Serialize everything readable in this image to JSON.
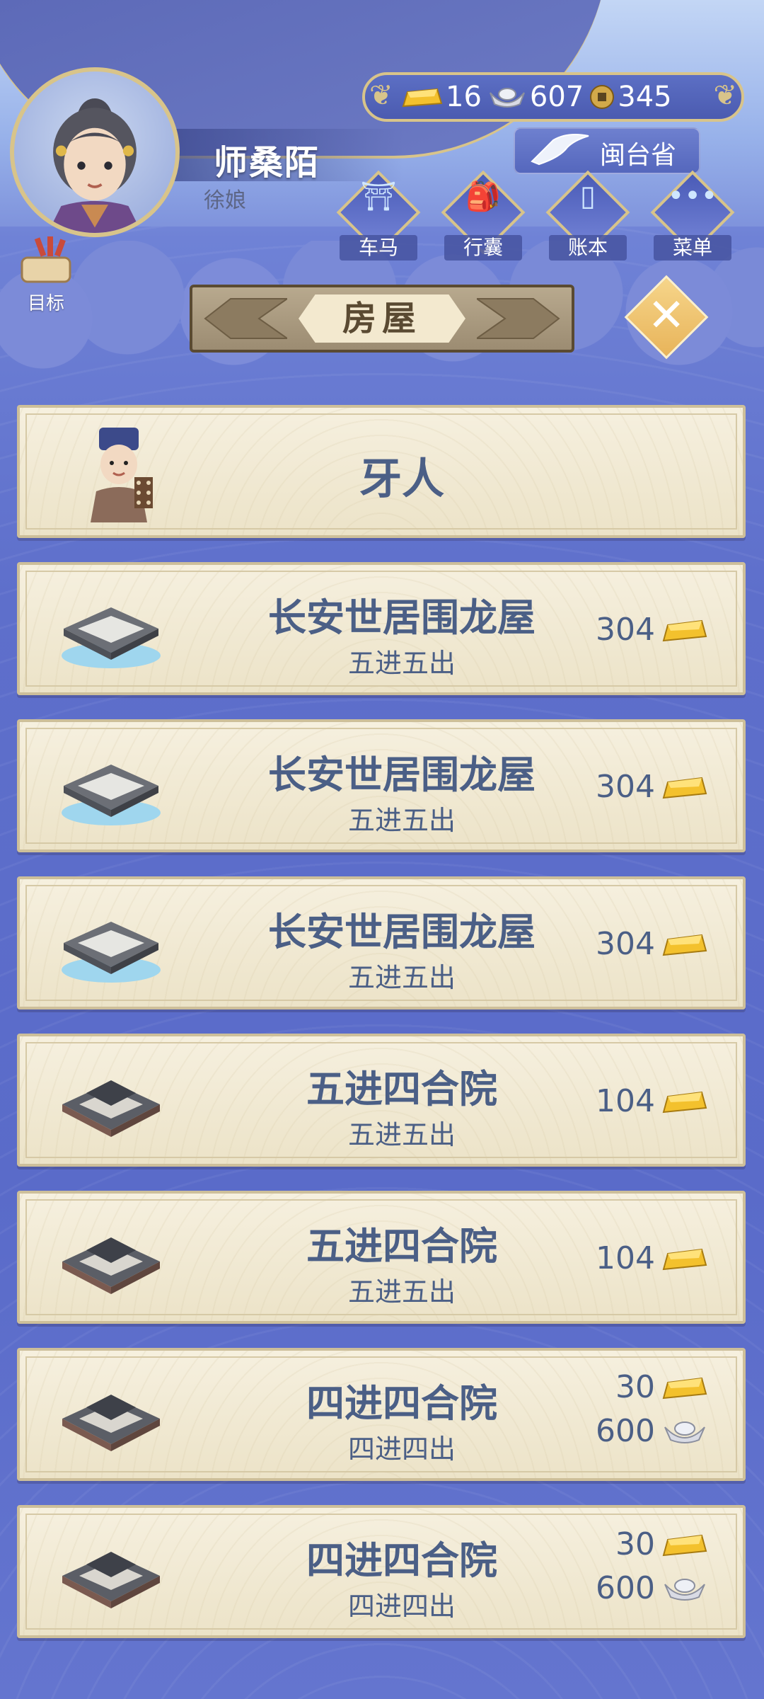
{
  "player": {
    "name": "师桑陌",
    "title": "徐娘"
  },
  "goal": {
    "label": "目标"
  },
  "currency": {
    "gold": "16",
    "silver": "607",
    "coin": "345"
  },
  "region": {
    "label": "闽台省"
  },
  "top_buttons": [
    {
      "label": "车马",
      "icon": "carriage-icon"
    },
    {
      "label": "行囊",
      "icon": "bag-icon"
    },
    {
      "label": "账本",
      "icon": "ledger-icon"
    },
    {
      "label": "菜单",
      "icon": "menu-dots-icon"
    }
  ],
  "section": {
    "title": "房屋"
  },
  "broker": {
    "title": "牙人"
  },
  "houses": [
    {
      "name": "长安世居围龙屋",
      "layout": "五进五出",
      "gold": "304",
      "silver": ""
    },
    {
      "name": "长安世居围龙屋",
      "layout": "五进五出",
      "gold": "304",
      "silver": ""
    },
    {
      "name": "长安世居围龙屋",
      "layout": "五进五出",
      "gold": "304",
      "silver": ""
    },
    {
      "name": "五进四合院",
      "layout": "五进五出",
      "gold": "104",
      "silver": ""
    },
    {
      "name": "五进四合院",
      "layout": "五进五出",
      "gold": "104",
      "silver": ""
    },
    {
      "name": "四进四合院",
      "layout": "四进四出",
      "gold": "30",
      "silver": "600"
    },
    {
      "name": "四进四合院",
      "layout": "四进四出",
      "gold": "30",
      "silver": "600"
    }
  ],
  "colors": {
    "accent_gold": "#d8c48a",
    "text_blue": "#4b5f86",
    "panel": "#f6f0df"
  }
}
